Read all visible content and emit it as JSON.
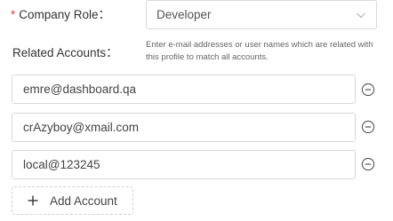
{
  "form": {
    "company_role": {
      "required_mark": "*",
      "label": "Company Role：",
      "value": "Developer",
      "arrow_icon": "chevron-down-icon"
    },
    "related_accounts": {
      "label": "Related Accounts：",
      "help_text": "Enter e-mail addresses or user names which are related with this profile to match all accounts.",
      "accounts": [
        {
          "value": "emre@dashboard.qa"
        },
        {
          "value": "crAzyboy@xmail.com"
        },
        {
          "value": "local@123245"
        }
      ],
      "remove_icon": "minus-circle-icon",
      "add_button_label": "Add Account",
      "add_icon": "plus-icon"
    }
  },
  "colors": {
    "required": "#e0443e",
    "border": "#d9d9d9",
    "text": "#333333"
  }
}
